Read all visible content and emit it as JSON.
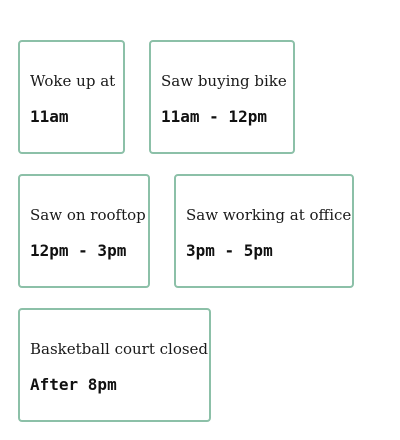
{
  "events": [
    {
      "label": "Woke up at",
      "time": "11am"
    },
    {
      "label": "Saw buying bike",
      "time": "11am - 12pm"
    },
    {
      "label": "Saw on rooftop",
      "time": "12pm - 3pm"
    },
    {
      "label": "Saw working at office",
      "time": "3pm - 5pm"
    },
    {
      "label": "Basketball court closed",
      "time": "After 8pm"
    }
  ]
}
